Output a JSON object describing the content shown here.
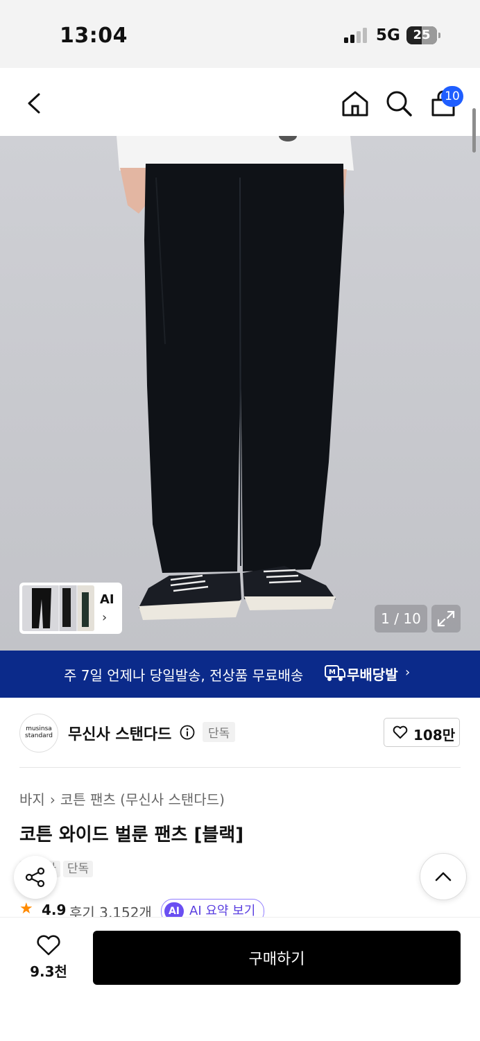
{
  "status_bar": {
    "time": "13:04",
    "network": "5G",
    "battery": "25"
  },
  "nav": {
    "back_icon": "chevron-left-icon",
    "home_icon": "home-icon",
    "search_icon": "search-icon",
    "cart_icon": "shopping-bag-icon",
    "cart_badge": "10"
  },
  "gallery": {
    "thumb_label": "AI",
    "thumb_chevron": "›",
    "counter": "1 / 10",
    "expand_icon": "expand-icon"
  },
  "banner": {
    "text": "주 7일 언제나 당일발송, 전상품 무료배송",
    "brand": "무배당발",
    "chevron": "›"
  },
  "brand": {
    "logo_line1": "musinsa",
    "logo_line2": "standard",
    "name": "무신사 스탠다드",
    "exclusive": "단독",
    "likes": "108만"
  },
  "product": {
    "breadcrumb": [
      "바지",
      "코튼 팬츠 (무신사 스탠다드)"
    ],
    "title": "코튼 와이드 벌룬 팬츠 [블랙]",
    "tags": [
      "무신사",
      "단독"
    ],
    "rating": "4.9",
    "reviews": "후기 3,152개",
    "ai_badge": "AI",
    "ai_summary": "AI 요약 보기"
  },
  "bottom": {
    "wish_count": "9.3천",
    "buy_label": "구매하기"
  },
  "colors": {
    "accent_blue": "#1f5eff",
    "banner_navy": "#0b2a8a",
    "ai_purple": "#6a4ff2",
    "star_orange": "#ff8a00"
  }
}
